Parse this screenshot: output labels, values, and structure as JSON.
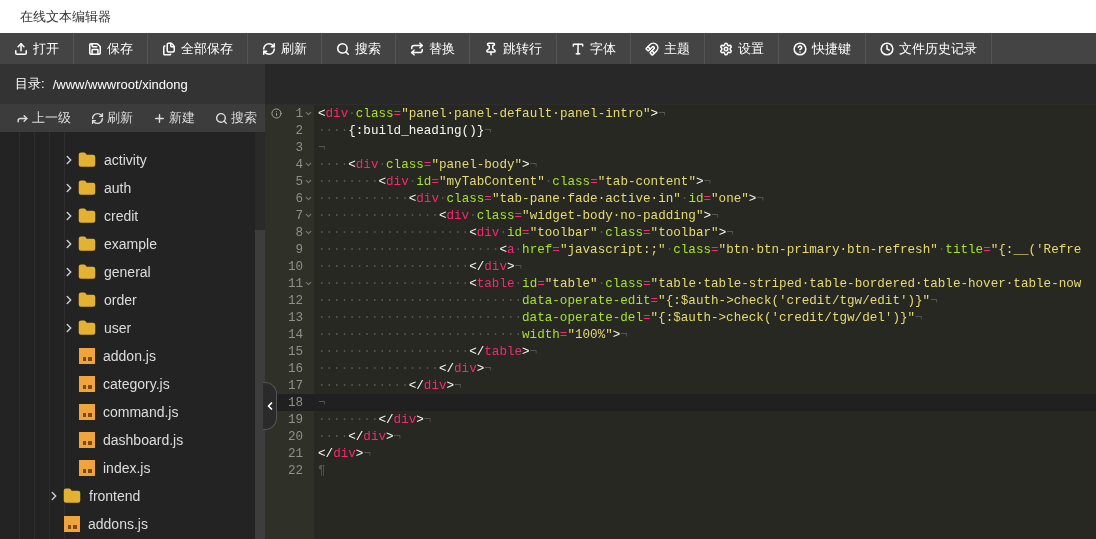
{
  "window": {
    "title": "在线文本编辑器"
  },
  "toolbar": [
    {
      "label": "打开"
    },
    {
      "label": "保存"
    },
    {
      "label": "全部保存"
    },
    {
      "label": "刷新"
    },
    {
      "label": "搜索"
    },
    {
      "label": "替换"
    },
    {
      "label": "跳转行"
    },
    {
      "label": "字体"
    },
    {
      "label": "主题"
    },
    {
      "label": "设置"
    },
    {
      "label": "快捷键"
    },
    {
      "label": "文件历史记录"
    }
  ],
  "sidebar": {
    "directory_label": "目录:",
    "directory_path": "/www/wwwroot/xindong",
    "actions": [
      {
        "label": "上一级"
      },
      {
        "label": "刷新"
      },
      {
        "label": "新建"
      },
      {
        "label": "搜索"
      }
    ],
    "tree": [
      {
        "kind": "group",
        "children": [
          {
            "kind": "folder",
            "name": "activity",
            "expanded": false
          },
          {
            "kind": "folder",
            "name": "auth",
            "expanded": false
          },
          {
            "kind": "folder",
            "name": "credit",
            "expanded": false
          },
          {
            "kind": "folder",
            "name": "example",
            "expanded": false
          },
          {
            "kind": "folder",
            "name": "general",
            "expanded": false
          },
          {
            "kind": "folder",
            "name": "order",
            "expanded": false
          },
          {
            "kind": "folder",
            "name": "user",
            "expanded": false
          },
          {
            "kind": "js",
            "name": "addon.js"
          },
          {
            "kind": "js",
            "name": "category.js"
          },
          {
            "kind": "js",
            "name": "command.js"
          },
          {
            "kind": "js",
            "name": "dashboard.js"
          },
          {
            "kind": "js",
            "name": "index.js"
          }
        ]
      },
      {
        "kind": "folder",
        "name": "frontend",
        "expanded": false
      },
      {
        "kind": "js",
        "name": "addons.js"
      }
    ]
  },
  "editor": {
    "lines": [
      {
        "number": "1",
        "fold": true,
        "info": true,
        "active": false,
        "tokens": [
          {
            "kind": "punct",
            "text": "<"
          },
          {
            "kind": "tag",
            "text": "div"
          },
          {
            "kind": "space",
            "text": "·"
          },
          {
            "kind": "attr",
            "text": "class"
          },
          {
            "kind": "op",
            "text": "="
          },
          {
            "kind": "string",
            "text": "\"panel·panel-default·panel-intro\""
          },
          {
            "kind": "punct",
            "text": ">"
          },
          {
            "kind": "space",
            "text": "¬"
          }
        ]
      },
      {
        "number": "2",
        "fold": false,
        "info": false,
        "active": false,
        "tokens": [
          {
            "kind": "space",
            "text": "····"
          },
          {
            "kind": "punct",
            "text": "{:build_heading()}"
          },
          {
            "kind": "space",
            "text": "¬"
          }
        ]
      },
      {
        "number": "3",
        "fold": false,
        "info": false,
        "active": false,
        "tokens": [
          {
            "kind": "space",
            "text": "¬"
          }
        ]
      },
      {
        "number": "4",
        "fold": true,
        "info": false,
        "active": false,
        "tokens": [
          {
            "kind": "space",
            "text": "····"
          },
          {
            "kind": "punct",
            "text": "<"
          },
          {
            "kind": "tag",
            "text": "div"
          },
          {
            "kind": "space",
            "text": "·"
          },
          {
            "kind": "attr",
            "text": "class"
          },
          {
            "kind": "op",
            "text": "="
          },
          {
            "kind": "string",
            "text": "\"panel-body\""
          },
          {
            "kind": "punct",
            "text": ">"
          },
          {
            "kind": "space",
            "text": "¬"
          }
        ]
      },
      {
        "number": "5",
        "fold": true,
        "info": false,
        "active": false,
        "tokens": [
          {
            "kind": "space",
            "text": "········"
          },
          {
            "kind": "punct",
            "text": "<"
          },
          {
            "kind": "tag",
            "text": "div"
          },
          {
            "kind": "space",
            "text": "·"
          },
          {
            "kind": "attr",
            "text": "id"
          },
          {
            "kind": "op",
            "text": "="
          },
          {
            "kind": "string",
            "text": "\"myTabContent\""
          },
          {
            "kind": "space",
            "text": "·"
          },
          {
            "kind": "attr",
            "text": "class"
          },
          {
            "kind": "op",
            "text": "="
          },
          {
            "kind": "string",
            "text": "\"tab-content\""
          },
          {
            "kind": "punct",
            "text": ">"
          },
          {
            "kind": "space",
            "text": "¬"
          }
        ]
      },
      {
        "number": "6",
        "fold": true,
        "info": false,
        "active": false,
        "tokens": [
          {
            "kind": "space",
            "text": "············"
          },
          {
            "kind": "punct",
            "text": "<"
          },
          {
            "kind": "tag",
            "text": "div"
          },
          {
            "kind": "space",
            "text": "·"
          },
          {
            "kind": "attr",
            "text": "class"
          },
          {
            "kind": "op",
            "text": "="
          },
          {
            "kind": "string",
            "text": "\"tab-pane·fade·active·in\""
          },
          {
            "kind": "space",
            "text": "·"
          },
          {
            "kind": "attr",
            "text": "id"
          },
          {
            "kind": "op",
            "text": "="
          },
          {
            "kind": "string",
            "text": "\"one\""
          },
          {
            "kind": "punct",
            "text": ">"
          },
          {
            "kind": "space",
            "text": "¬"
          }
        ]
      },
      {
        "number": "7",
        "fold": true,
        "info": false,
        "active": false,
        "tokens": [
          {
            "kind": "space",
            "text": "················"
          },
          {
            "kind": "punct",
            "text": "<"
          },
          {
            "kind": "tag",
            "text": "div"
          },
          {
            "kind": "space",
            "text": "·"
          },
          {
            "kind": "attr",
            "text": "class"
          },
          {
            "kind": "op",
            "text": "="
          },
          {
            "kind": "string",
            "text": "\"widget-body·no-padding\""
          },
          {
            "kind": "punct",
            "text": ">"
          },
          {
            "kind": "space",
            "text": "¬"
          }
        ]
      },
      {
        "number": "8",
        "fold": true,
        "info": false,
        "active": false,
        "tokens": [
          {
            "kind": "space",
            "text": "····················"
          },
          {
            "kind": "punct",
            "text": "<"
          },
          {
            "kind": "tag",
            "text": "div"
          },
          {
            "kind": "space",
            "text": "·"
          },
          {
            "kind": "attr",
            "text": "id"
          },
          {
            "kind": "op",
            "text": "="
          },
          {
            "kind": "string",
            "text": "\"toolbar\""
          },
          {
            "kind": "space",
            "text": "·"
          },
          {
            "kind": "attr",
            "text": "class"
          },
          {
            "kind": "op",
            "text": "="
          },
          {
            "kind": "string",
            "text": "\"toolbar\""
          },
          {
            "kind": "punct",
            "text": ">"
          },
          {
            "kind": "space",
            "text": "¬"
          }
        ]
      },
      {
        "number": "9",
        "fold": false,
        "info": false,
        "active": false,
        "tokens": [
          {
            "kind": "space",
            "text": "························"
          },
          {
            "kind": "punct",
            "text": "<"
          },
          {
            "kind": "tag",
            "text": "a"
          },
          {
            "kind": "space",
            "text": "·"
          },
          {
            "kind": "attr",
            "text": "href"
          },
          {
            "kind": "op",
            "text": "="
          },
          {
            "kind": "string",
            "text": "\"javascript:;\""
          },
          {
            "kind": "space",
            "text": "·"
          },
          {
            "kind": "attr",
            "text": "class"
          },
          {
            "kind": "op",
            "text": "="
          },
          {
            "kind": "string",
            "text": "\"btn·btn-primary·btn-refresh\""
          },
          {
            "kind": "space",
            "text": "·"
          },
          {
            "kind": "attr",
            "text": "title"
          },
          {
            "kind": "op",
            "text": "="
          },
          {
            "kind": "string",
            "text": "\"{:__('Refre"
          }
        ]
      },
      {
        "number": "10",
        "fold": false,
        "info": false,
        "active": false,
        "tokens": [
          {
            "kind": "space",
            "text": "····················"
          },
          {
            "kind": "punct",
            "text": "</"
          },
          {
            "kind": "tag",
            "text": "div"
          },
          {
            "kind": "punct",
            "text": ">"
          },
          {
            "kind": "space",
            "text": "¬"
          }
        ]
      },
      {
        "number": "11",
        "fold": true,
        "info": false,
        "active": false,
        "tokens": [
          {
            "kind": "space",
            "text": "····················"
          },
          {
            "kind": "punct",
            "text": "<"
          },
          {
            "kind": "tag",
            "text": "table"
          },
          {
            "kind": "space",
            "text": "·"
          },
          {
            "kind": "attr",
            "text": "id"
          },
          {
            "kind": "op",
            "text": "="
          },
          {
            "kind": "string",
            "text": "\"table\""
          },
          {
            "kind": "space",
            "text": "·"
          },
          {
            "kind": "attr",
            "text": "class"
          },
          {
            "kind": "op",
            "text": "="
          },
          {
            "kind": "string",
            "text": "\"table·table-striped·table-bordered·table-hover·table-now"
          }
        ]
      },
      {
        "number": "12",
        "fold": false,
        "info": false,
        "active": false,
        "tokens": [
          {
            "kind": "space",
            "text": "···························"
          },
          {
            "kind": "attr",
            "text": "data-operate-edit"
          },
          {
            "kind": "op",
            "text": "="
          },
          {
            "kind": "string",
            "text": "\"{:$auth->check('credit/tgw/edit')}\""
          },
          {
            "kind": "space",
            "text": "¬"
          }
        ]
      },
      {
        "number": "13",
        "fold": false,
        "info": false,
        "active": false,
        "tokens": [
          {
            "kind": "space",
            "text": "···························"
          },
          {
            "kind": "attr",
            "text": "data-operate-del"
          },
          {
            "kind": "op",
            "text": "="
          },
          {
            "kind": "string",
            "text": "\"{:$auth->check('credit/tgw/del')}\""
          },
          {
            "kind": "space",
            "text": "¬"
          }
        ]
      },
      {
        "number": "14",
        "fold": false,
        "info": false,
        "active": false,
        "tokens": [
          {
            "kind": "space",
            "text": "···························"
          },
          {
            "kind": "attr",
            "text": "width"
          },
          {
            "kind": "op",
            "text": "="
          },
          {
            "kind": "string",
            "text": "\"100%\""
          },
          {
            "kind": "punct",
            "text": ">"
          },
          {
            "kind": "space",
            "text": "¬"
          }
        ]
      },
      {
        "number": "15",
        "fold": false,
        "info": false,
        "active": false,
        "tokens": [
          {
            "kind": "space",
            "text": "····················"
          },
          {
            "kind": "punct",
            "text": "</"
          },
          {
            "kind": "tag",
            "text": "table"
          },
          {
            "kind": "punct",
            "text": ">"
          },
          {
            "kind": "space",
            "text": "¬"
          }
        ]
      },
      {
        "number": "16",
        "fold": false,
        "info": false,
        "active": false,
        "tokens": [
          {
            "kind": "space",
            "text": "················"
          },
          {
            "kind": "punct",
            "text": "</"
          },
          {
            "kind": "tag",
            "text": "div"
          },
          {
            "kind": "punct",
            "text": ">"
          },
          {
            "kind": "space",
            "text": "¬"
          }
        ]
      },
      {
        "number": "17",
        "fold": false,
        "info": false,
        "active": false,
        "tokens": [
          {
            "kind": "space",
            "text": "············"
          },
          {
            "kind": "punct",
            "text": "</"
          },
          {
            "kind": "tag",
            "text": "div"
          },
          {
            "kind": "punct",
            "text": ">"
          },
          {
            "kind": "space",
            "text": "¬"
          }
        ]
      },
      {
        "number": "18",
        "fold": false,
        "info": false,
        "active": true,
        "tokens": [
          {
            "kind": "space",
            "text": "¬"
          }
        ]
      },
      {
        "number": "19",
        "fold": false,
        "info": false,
        "active": false,
        "tokens": [
          {
            "kind": "space",
            "text": "········"
          },
          {
            "kind": "punct",
            "text": "</"
          },
          {
            "kind": "tag",
            "text": "div"
          },
          {
            "kind": "punct",
            "text": ">"
          },
          {
            "kind": "space",
            "text": "¬"
          }
        ]
      },
      {
        "number": "20",
        "fold": false,
        "info": false,
        "active": false,
        "tokens": [
          {
            "kind": "space",
            "text": "····"
          },
          {
            "kind": "punct",
            "text": "</"
          },
          {
            "kind": "tag",
            "text": "div"
          },
          {
            "kind": "punct",
            "text": ">"
          },
          {
            "kind": "space",
            "text": "¬"
          }
        ]
      },
      {
        "number": "21",
        "fold": false,
        "info": false,
        "active": false,
        "tokens": [
          {
            "kind": "punct",
            "text": "</"
          },
          {
            "kind": "tag",
            "text": "div"
          },
          {
            "kind": "punct",
            "text": ">"
          },
          {
            "kind": "space",
            "text": "¬"
          }
        ]
      },
      {
        "number": "22",
        "fold": false,
        "info": false,
        "active": false,
        "tokens": [
          {
            "kind": "space",
            "text": "¶"
          }
        ]
      }
    ]
  }
}
